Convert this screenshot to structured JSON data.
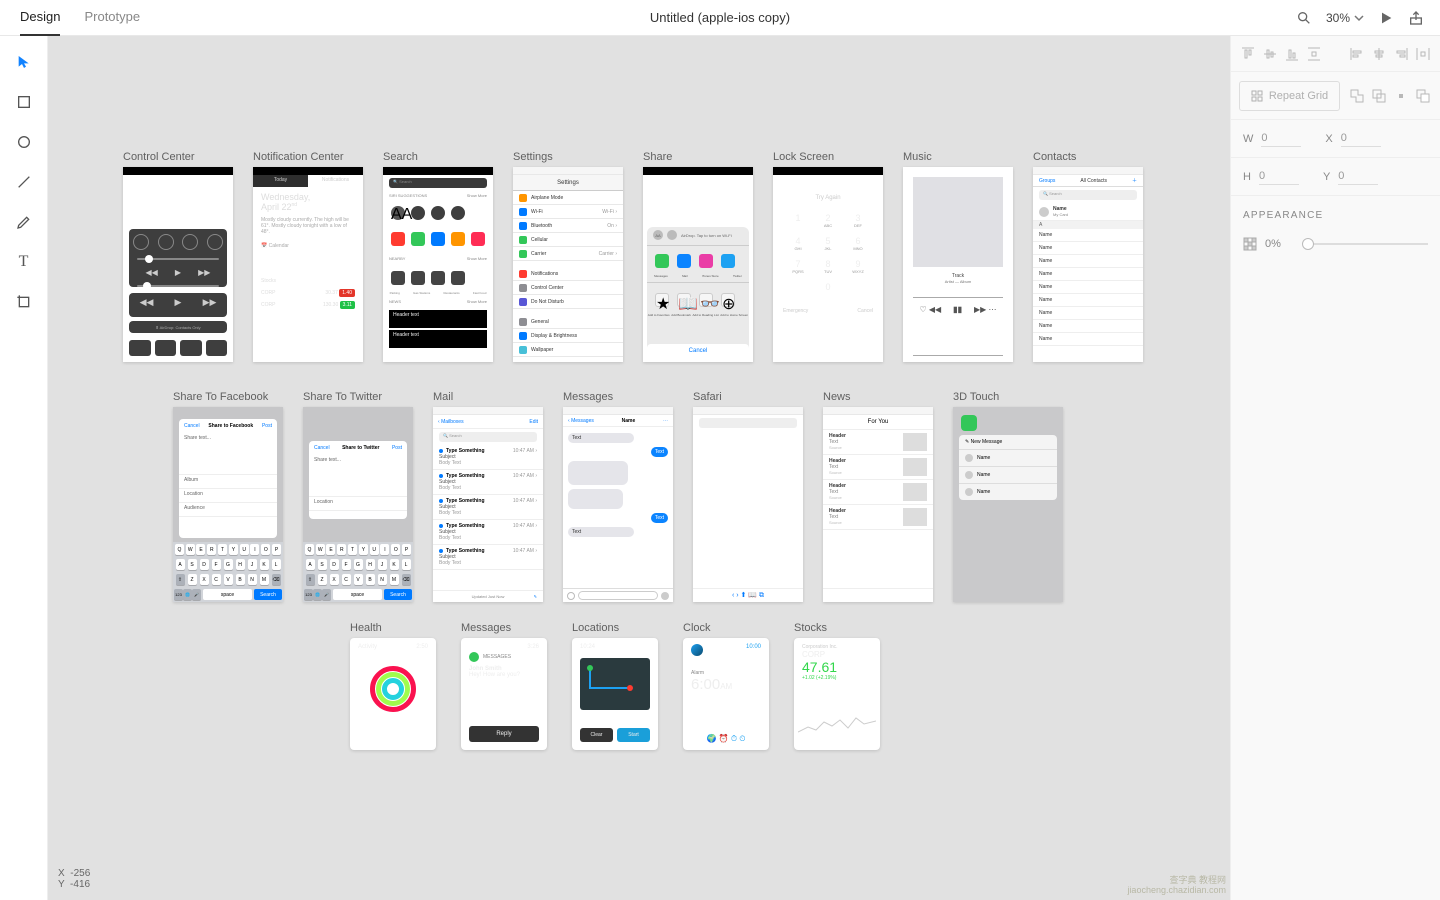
{
  "header": {
    "tabs": [
      "Design",
      "Prototype"
    ],
    "title": "Untitled (apple-ios copy)",
    "zoom": "30%"
  },
  "coords": {
    "x": "-256",
    "y": "-416"
  },
  "rightpanel": {
    "repeat": "Repeat Grid",
    "W": "W",
    "Wv": "0",
    "H": "H",
    "Hv": "0",
    "X": "X",
    "Xv": "0",
    "Y": "Y",
    "Yv": "0",
    "appearance": "APPEARANCE",
    "opacity": "0%"
  },
  "artboards": {
    "row1": [
      {
        "label": "Control Center"
      },
      {
        "label": "Notification Center",
        "date": "Wednesday,",
        "date2": "April 22",
        "weather": "Mostly cloudy currently. The high will be 61°. Mostly cloudy tonight with a low of 48°.",
        "cal": "Calendar",
        "stk1": "Stocks",
        "stk2": "CORP",
        "s1": "30.37",
        "s1c": "1.40",
        "s2": "130.30",
        "s2c": "3.11"
      },
      {
        "label": "Search",
        "hdr": "SIRI SUGGESTIONS",
        "sh": "Show More",
        "n": "NEARBY",
        "nb": [
          "Parking",
          "Gas Stations",
          "Restaurants",
          "Fast Food"
        ],
        "news": "NEWS",
        "h1": "Header text",
        "h2": "Header text"
      },
      {
        "label": "Settings",
        "title": "Settings",
        "items": [
          "Airplane Mode",
          "Wi-Fi",
          "Bluetooth",
          "Cellular",
          "Carrier",
          "Notifications",
          "Control Center",
          "Do Not Disturb",
          "General",
          "Display & Brightness",
          "Wallpaper"
        ]
      },
      {
        "label": "Share",
        "air": "AirDrop. Tap to turn on Wi-Fi",
        "apps": [
          "Messages",
          "Mail",
          "iTunes Store",
          "Twitter"
        ],
        "acts": [
          "Add to Favorites",
          "Add Bookmark",
          "Add to Reading List",
          "Add to Home Screen"
        ],
        "cancel": "Cancel"
      },
      {
        "label": "Lock Screen",
        "try": "Try Again",
        "keys": [
          [
            "1",
            ""
          ],
          [
            "2",
            "ABC"
          ],
          [
            "3",
            "DEF"
          ],
          [
            "4",
            "GHI"
          ],
          [
            "5",
            "JKL"
          ],
          [
            "6",
            "MNO"
          ],
          [
            "7",
            "PQRS"
          ],
          [
            "8",
            "TUV"
          ],
          [
            "9",
            "WXYZ"
          ]
        ],
        "zero": "0",
        "emg": "Emergency",
        "can": "Cancel"
      },
      {
        "label": "Music",
        "track": "Track",
        "artist": "Artist — Album"
      },
      {
        "label": "Contacts",
        "groups": "Groups",
        "all": "All Contacts",
        "me": "Name",
        "mesub": "My Card",
        "letter": "A",
        "name": "Name"
      }
    ],
    "row2": [
      {
        "label": "Share To Facebook",
        "cancel": "Cancel",
        "title": "Share to Facebook",
        "post": "Post",
        "body": "Share text...",
        "r": [
          "Album",
          "Location",
          "Audience"
        ]
      },
      {
        "label": "Share To Twitter",
        "cancel": "Cancel",
        "title": "Share to Twitter",
        "post": "Post",
        "body": "Share text...",
        "r": [
          "Location"
        ]
      },
      {
        "label": "Mail",
        "back": "Mailboxes",
        "edit": "Edit",
        "search": "Search",
        "items": [
          {
            "s": "Type Something",
            "sub": "Subject",
            "b": "Body Text",
            "t": "10:47 AM"
          }
        ],
        "upd": "Updated Just Now"
      },
      {
        "label": "Messages",
        "back": "Messages",
        "name": "Name",
        "bubbles": [
          "Text",
          "Text",
          "Text",
          "Text",
          "Text"
        ]
      },
      {
        "label": "Safari"
      },
      {
        "label": "News",
        "foryou": "For You",
        "hdr": "Header",
        "t": "Text",
        "s": "Source"
      },
      {
        "label": "3D Touch",
        "new": "New Message",
        "n": "Name"
      }
    ],
    "row3": [
      {
        "label": "Health",
        "act": "Activity",
        "time": "2:50"
      },
      {
        "label": "Messages",
        "time": "3:26",
        "app": "MESSAGES",
        "from": "John Smith",
        "msg": "Hey! How are you?",
        "reply": "Reply"
      },
      {
        "label": "Locations",
        "time": "10:24",
        "clear": "Clear",
        "start": "Start"
      },
      {
        "label": "Clock",
        "time": "10:00",
        "alarm": "Alarm",
        "atime": "6:00",
        "am": "AM"
      },
      {
        "label": "Stocks",
        "corp": "Corporation Inc.",
        "sym": "CORP",
        "price": "47.61",
        "chg": "+1.02 (+2.19%)"
      }
    ]
  },
  "keyboard": {
    "r1": [
      "Q",
      "W",
      "E",
      "R",
      "T",
      "Y",
      "U",
      "I",
      "O",
      "P"
    ],
    "r2": [
      "A",
      "S",
      "D",
      "F",
      "G",
      "H",
      "J",
      "K",
      "L"
    ],
    "r3": [
      "Z",
      "X",
      "C",
      "V",
      "B",
      "N",
      "M"
    ],
    "space": "space",
    "search": "Search"
  },
  "watermark": {
    "l1": "查字典 教程网",
    "l2": "jiaocheng.chazidian.com"
  }
}
